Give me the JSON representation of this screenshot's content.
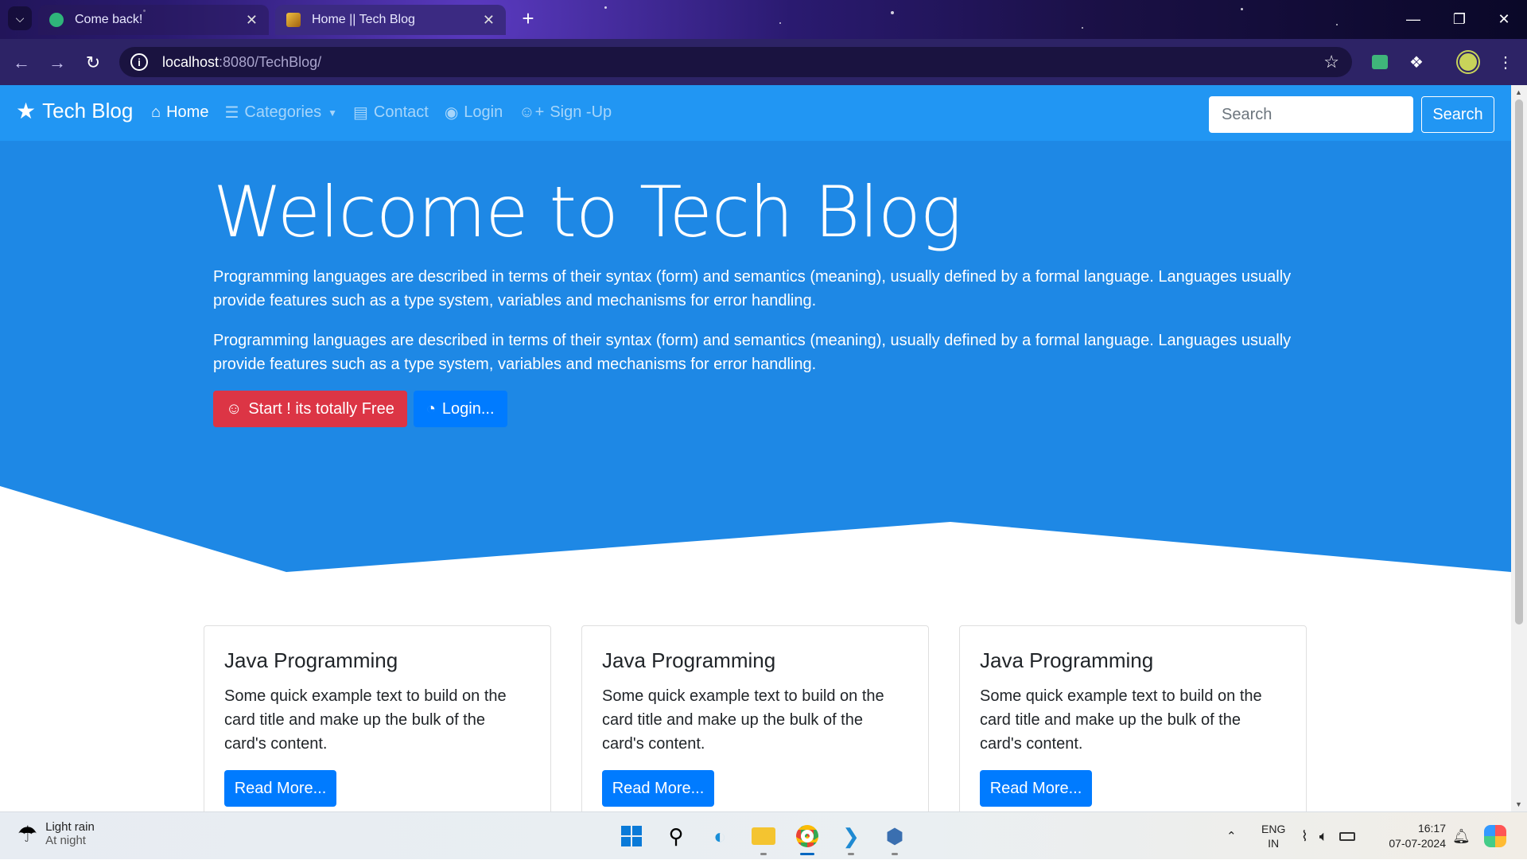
{
  "browser": {
    "tabs": [
      {
        "title": "Come back!",
        "active": false
      },
      {
        "title": "Home || Tech Blog",
        "active": true
      }
    ],
    "url_host": "localhost",
    "url_rest": ":8080/TechBlog/"
  },
  "navbar": {
    "brand": "Tech Blog",
    "links": [
      {
        "label": "Home",
        "icon": "home-icon",
        "active": true
      },
      {
        "label": "Categories",
        "icon": "list-icon",
        "active": false,
        "dropdown": true
      },
      {
        "label": "Contact",
        "icon": "contact-card-icon",
        "active": false
      },
      {
        "label": "Login",
        "icon": "user-circle-icon",
        "active": false
      },
      {
        "label": "Sign -Up",
        "icon": "user-plus-icon",
        "active": false
      }
    ],
    "search_placeholder": "Search",
    "search_button": "Search"
  },
  "hero": {
    "title": "Welcome to Tech Blog",
    "paragraphs": [
      "Programming languages are described in terms of their syntax (form) and semantics (meaning), usually defined by a formal language. Languages usually provide features such as a type system, variables and mechanisms for error handling.",
      "Programming languages are described in terms of their syntax (form) and semantics (meaning), usually defined by a formal language. Languages usually provide features such as a type system, variables and mechanisms for error handling."
    ],
    "primary_button": "Start ! its totally Free",
    "secondary_button": "Login...",
    "colors": {
      "hero": "#1e88e5",
      "navbar": "#2196f3"
    }
  },
  "cards": [
    {
      "title": "Java Programming",
      "text": "Some quick example text to build on the card title and make up the bulk of the card's content.",
      "button": "Read More..."
    },
    {
      "title": "Java Programming",
      "text": "Some quick example text to build on the card title and make up the bulk of the card's content.",
      "button": "Read More..."
    },
    {
      "title": "Java Programming",
      "text": "Some quick example text to build on the card title and make up the bulk of the card's content.",
      "button": "Read More..."
    }
  ],
  "taskbar": {
    "weather_title": "Light rain",
    "weather_sub": "At night",
    "lang_top": "ENG",
    "lang_bottom": "IN",
    "time": "16:17",
    "date": "07-07-2024"
  }
}
